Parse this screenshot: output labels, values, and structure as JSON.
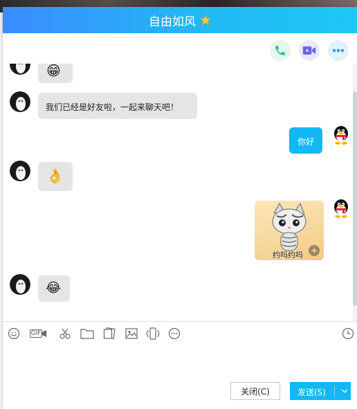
{
  "window": {
    "title": "自由如风"
  },
  "header": {
    "phone_icon": "phone-icon",
    "video_icon": "video-icon",
    "more_icon": "more-icon"
  },
  "messages": [
    {
      "side": "left",
      "type": "emoji",
      "emoji": "😁"
    },
    {
      "side": "left",
      "type": "text",
      "text": "我们已经是好友啦，一起来聊天吧！"
    },
    {
      "side": "right",
      "type": "text",
      "text": "你好"
    },
    {
      "side": "left",
      "type": "emoji",
      "emoji": "👌"
    },
    {
      "side": "right",
      "type": "sticker",
      "caption": "约吗约吗"
    },
    {
      "side": "left",
      "type": "emoji",
      "emoji": "😂"
    }
  ],
  "input_toolbar": [
    "emoji-icon",
    "gif-icon",
    "scissors-icon",
    "folder-icon",
    "gallery-icon",
    "image-icon",
    "shake-icon",
    "more-options-icon",
    "history-icon"
  ],
  "input_toolbar_gif_label": "GIF",
  "buttons": {
    "close": "关闭(C)",
    "send": "发送(S)"
  },
  "colors": {
    "accent": "#12b7f5",
    "title_gradient_start": "#3a8cff",
    "title_gradient_end": "#1ec8f5"
  }
}
